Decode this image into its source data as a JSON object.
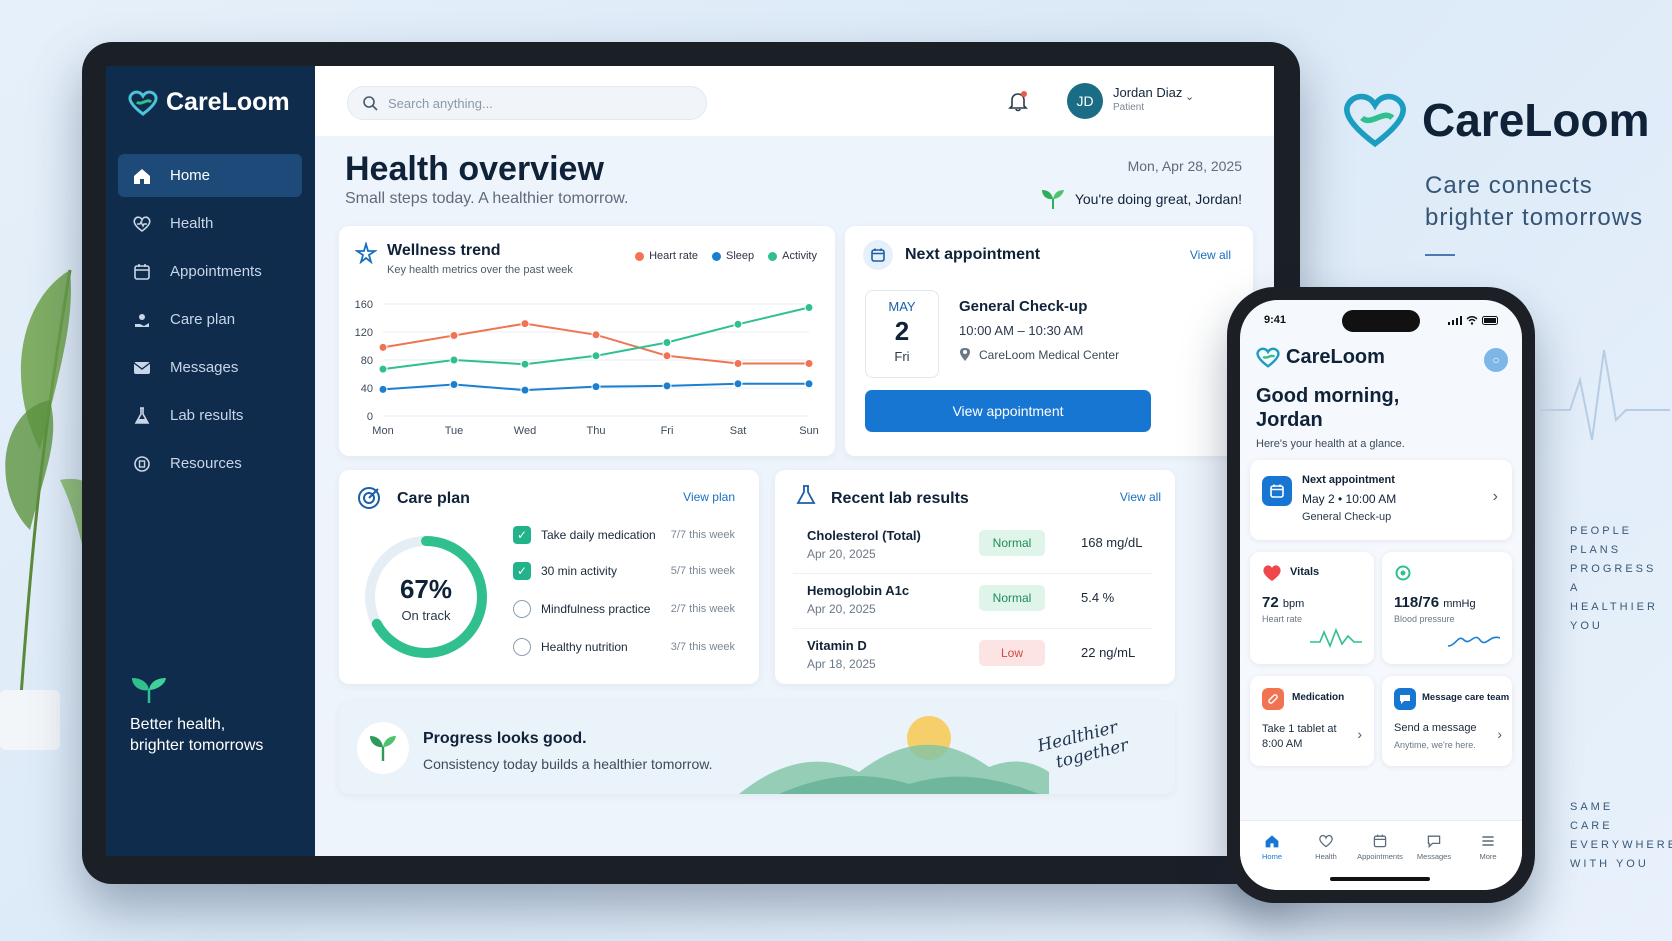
{
  "app": {
    "name": "CareLoom"
  },
  "sidebar": {
    "items": [
      {
        "label": "Home",
        "icon": "home-icon"
      },
      {
        "label": "Health",
        "icon": "heart-icon"
      },
      {
        "label": "Appointments",
        "icon": "calendar-icon"
      },
      {
        "label": "Care plan",
        "icon": "care-plan-icon"
      },
      {
        "label": "Messages",
        "icon": "message-icon"
      },
      {
        "label": "Lab results",
        "icon": "flask-icon"
      },
      {
        "label": "Resources",
        "icon": "resources-icon"
      }
    ],
    "footer_text": "Better health, brighter tomorrows"
  },
  "topbar": {
    "search_placeholder": "Search anything...",
    "user_initials": "JD",
    "user_name": "Jordan Diaz",
    "user_role": "Patient"
  },
  "header": {
    "title": "Health overview",
    "subtitle": "Small steps today. A healthier tomorrow.",
    "date": "Mon, Apr 28, 2025",
    "encouragement": "You're doing great, Jordan!"
  },
  "wellness": {
    "title": "Wellness trend",
    "subtitle": "Key health metrics over the past week"
  },
  "chart_data": {
    "type": "line",
    "title": "Wellness trend",
    "x": [
      "Mon",
      "Tue",
      "Wed",
      "Thu",
      "Fri",
      "Sat",
      "Sun"
    ],
    "ylim": [
      0,
      160
    ],
    "yticks": [
      0,
      40,
      80,
      120,
      160
    ],
    "grid": true,
    "legend_position": "top-right",
    "series": [
      {
        "name": "Heart rate",
        "color": "#f07452",
        "values": [
          98,
          115,
          132,
          116,
          86,
          75,
          75
        ]
      },
      {
        "name": "Sleep",
        "color": "#1a7fd1",
        "values": [
          38,
          45,
          37,
          42,
          43,
          46,
          46
        ]
      },
      {
        "name": "Activity",
        "color": "#2fc08e",
        "values": [
          67,
          80,
          74,
          86,
          105,
          131,
          155
        ]
      }
    ]
  },
  "next_appointment": {
    "title": "Next appointment",
    "view_all": "View all",
    "month": "MAY",
    "day": "2",
    "weekday": "Fri",
    "name": "General Check-up",
    "time": "10:00 AM – 10:30 AM",
    "location": "CareLoom Medical Center",
    "button": "View appointment"
  },
  "care_plan": {
    "title": "Care plan",
    "link": "View plan",
    "progress_percent": 67,
    "progress_label": "67%",
    "progress_caption": "On track",
    "tasks": [
      {
        "label": "Take daily medication",
        "count": "7/7 this week",
        "done": true
      },
      {
        "label": "30 min activity",
        "count": "5/7 this week",
        "done": true
      },
      {
        "label": "Mindfulness practice",
        "count": "2/7 this week",
        "done": false
      },
      {
        "label": "Healthy nutrition",
        "count": "3/7 this week",
        "done": false
      }
    ]
  },
  "labs": {
    "title": "Recent lab results",
    "view_all": "View all",
    "rows": [
      {
        "name": "Cholesterol (Total)",
        "date": "Apr 20, 2025",
        "status": "Normal",
        "value": "168 mg/dL"
      },
      {
        "name": "Hemoglobin A1c",
        "date": "Apr 20, 2025",
        "status": "Normal",
        "value": "5.4 %"
      },
      {
        "name": "Vitamin D",
        "date": "Apr 18, 2025",
        "status": "Low",
        "value": "22 ng/mL"
      }
    ]
  },
  "banner": {
    "title": "Progress looks good.",
    "text": "Consistency today builds a healthier tomorrow.",
    "script_line1": "Healthier",
    "script_line2": "together"
  },
  "phone": {
    "time": "9:41",
    "app_name": "CareLoom",
    "greeting": "Good morning, Jordan",
    "subtitle": "Here's your health at a glance.",
    "appt_title": "Next appointment",
    "appt_when": "May 2 • 10:00 AM",
    "appt_name": "General Check-up",
    "vitals_title": "Vitals",
    "heart_value": "72",
    "heart_unit": "bpm",
    "heart_label": "Heart rate",
    "bp_value": "118/76",
    "bp_unit": "mmHg",
    "bp_label": "Blood pressure",
    "med_title": "Medication",
    "med_text": "Take 1 tablet at 8:00 AM",
    "msg_title": "Message care team",
    "msg_text": "Send a message",
    "msg_sub": "Anytime, we're here.",
    "tabs": [
      "Home",
      "Health",
      "Appointments",
      "Messages",
      "More"
    ]
  },
  "brand_panel": {
    "name": "CareLoom",
    "tagline_1": "Care connects",
    "tagline_2": "brighter tomorrows",
    "words_top": [
      "PEOPLE",
      "PLANS",
      "PROGRESS",
      "A HEALTHIER",
      "YOU"
    ],
    "words_bottom": [
      "SAME",
      "CARE",
      "EVERYWHERE",
      "WITH YOU"
    ]
  },
  "colors": {
    "navy": "#0f2c4c",
    "primary": "#1776d2",
    "teal": "#22b38a",
    "coral": "#f07452"
  }
}
